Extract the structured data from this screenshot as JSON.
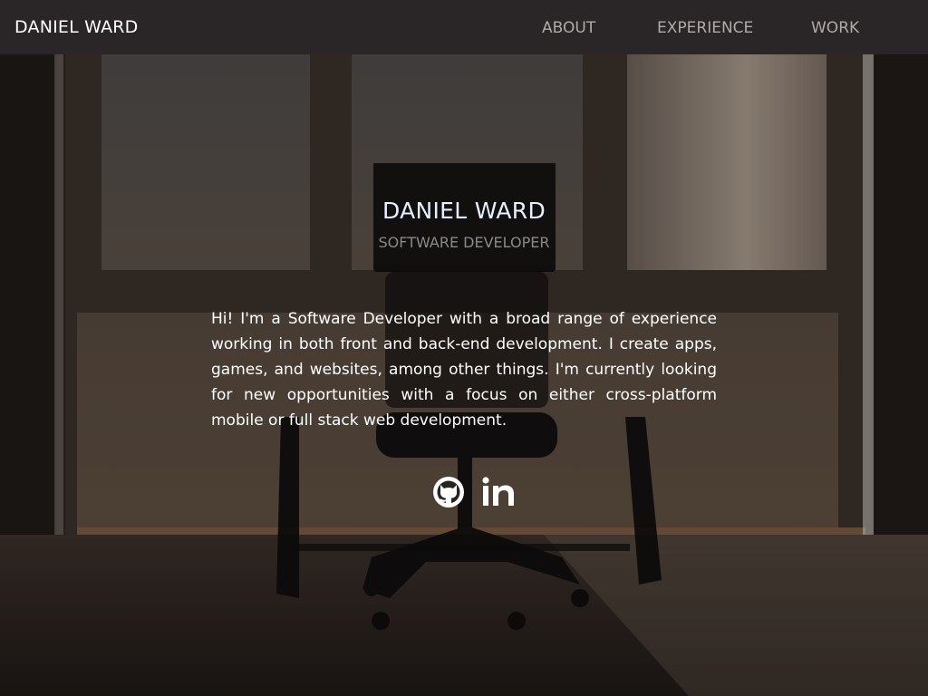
{
  "nav": {
    "brand": "DANIEL WARD",
    "links": [
      {
        "label": "ABOUT"
      },
      {
        "label": "EXPERIENCE"
      },
      {
        "label": "WORK"
      }
    ]
  },
  "hero": {
    "name": "DANIEL WARD",
    "role": "SOFTWARE DEVELOPER",
    "bio": "Hi! I'm a Software Developer with a broad range of experience working in both front and back-end development. I create apps, games, and websites, among other things. I'm currently looking for new opportunities with a focus on either cross-platform mobile or full stack web development.",
    "social": [
      {
        "icon": "github-icon"
      },
      {
        "icon": "linkedin-icon"
      }
    ]
  },
  "colors": {
    "navbar": "#2a2526",
    "brand_text": "#ffffff",
    "nav_text": "#b0aaa8",
    "name_text": "#e6f0ff",
    "role_text": "#8c8885"
  }
}
